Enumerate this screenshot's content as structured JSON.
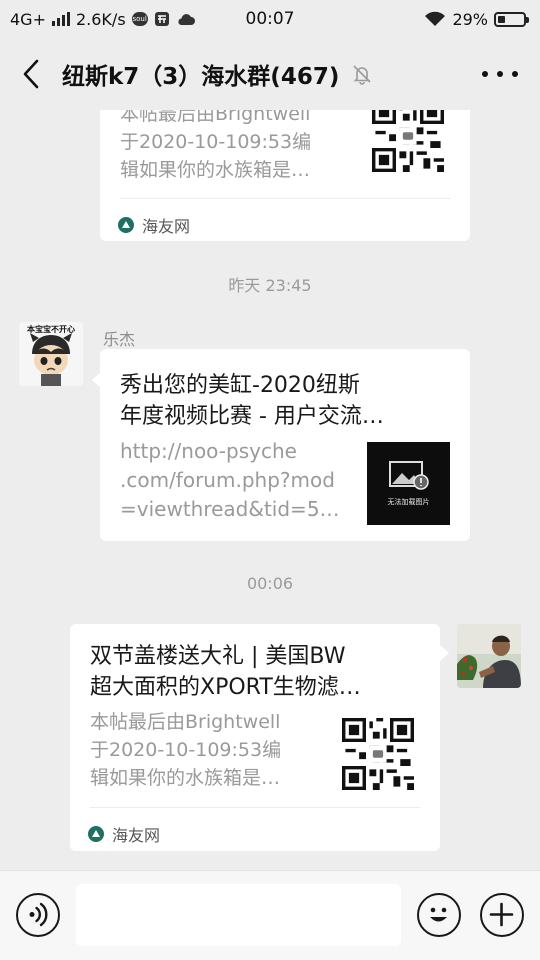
{
  "status_bar": {
    "network": "4G+",
    "speed": "2.6K/s",
    "time": "00:07",
    "battery": "29%",
    "battery_level": 0.29
  },
  "header": {
    "title": "纽斯k7（3）海水群(467)",
    "back_icon": "chevron-left-icon",
    "mute_icon": "bell-off-icon",
    "more_icon": "more-dots-icon"
  },
  "messages": [
    {
      "type": "link-card",
      "side": "left",
      "desc_lines": [
        "本帖最后由Brightwell",
        "于2020-10-109:53编",
        "辑如果你的水族箱是…"
      ],
      "source": "海友网",
      "thumb": "qr-code"
    },
    {
      "type": "time",
      "text": "昨天 23:45"
    },
    {
      "type": "link-card",
      "side": "left",
      "sender": "乐杰",
      "avatar_caption": "本宝宝不开心",
      "title_lines": [
        "秀出您的美缸-2020纽斯",
        "年度视频比赛 - 用户交流…"
      ],
      "desc_lines": [
        "http://noo-psyche",
        ".com/forum.php?mod",
        "=viewthread&tid=57…"
      ],
      "thumb": "image-placeholder",
      "thumb_caption": "无法加载图片"
    },
    {
      "type": "time",
      "text": "00:06"
    },
    {
      "type": "link-card",
      "side": "right",
      "title_lines": [
        "双节盖楼送大礼 | 美国BW",
        "超大面积的XPORT生物滤…"
      ],
      "desc_lines": [
        "本帖最后由Brightwell",
        "于2020-10-109:53编",
        "辑如果你的水族箱是…"
      ],
      "source": "海友网",
      "thumb": "qr-code"
    }
  ],
  "input_bar": {
    "voice_icon": "voice-icon",
    "emoji_icon": "emoji-icon",
    "plus_icon": "plus-icon"
  },
  "colors": {
    "background": "#ededed",
    "card": "#ffffff",
    "muted_text": "#9a9a9a",
    "source_logo": "#1f6f63"
  }
}
